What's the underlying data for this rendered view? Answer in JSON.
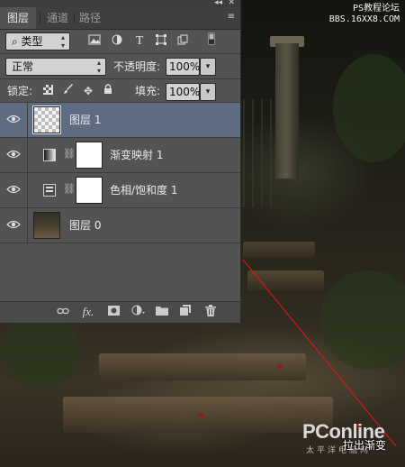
{
  "panel": {
    "tabs": [
      {
        "label": "图层",
        "active": true
      },
      {
        "label": "通道",
        "active": false
      },
      {
        "label": "路径",
        "active": false
      }
    ],
    "collapse_glyph": "◂◂",
    "close_glyph": "✕",
    "menu_glyph": "≡",
    "filter": {
      "kind_label": "类型",
      "icons": [
        "image-filter-icon",
        "adjustment-filter-icon",
        "type-filter-icon",
        "shape-filter-icon",
        "smart-object-filter-icon",
        "filter-toggle-icon"
      ]
    },
    "blend_mode": "正常",
    "opacity_label": "不透明度:",
    "opacity_value": "100%",
    "lock_label": "锁定:",
    "fill_label": "填充:",
    "fill_value": "100%",
    "layers": [
      {
        "name": "图层 1",
        "thumb": "transparent",
        "selected": true,
        "visible": true
      },
      {
        "name": "渐变映射 1",
        "thumb": "gradient-map-adjustment",
        "selected": false,
        "visible": true
      },
      {
        "name": "色相/饱和度 1",
        "thumb": "hue-saturation-adjustment",
        "selected": false,
        "visible": true
      },
      {
        "name": "图层 0",
        "thumb": "photo",
        "selected": false,
        "visible": true
      }
    ],
    "bottom_icons": [
      "link-icon",
      "fx-icon",
      "mask-icon",
      "new-adjustment-icon",
      "folder-icon",
      "new-layer-icon",
      "trash-icon"
    ]
  },
  "watermark": {
    "line1": "PS教程论坛",
    "line2": "BBS.16XX8.COM"
  },
  "logo": {
    "brand": "PConline",
    "sub": "太平洋电脑网"
  },
  "annotation": "拉出渐变",
  "colors": {
    "panel_bg": "#535353",
    "selected_row": "#5e6b80",
    "guide_line": "#d01818"
  }
}
